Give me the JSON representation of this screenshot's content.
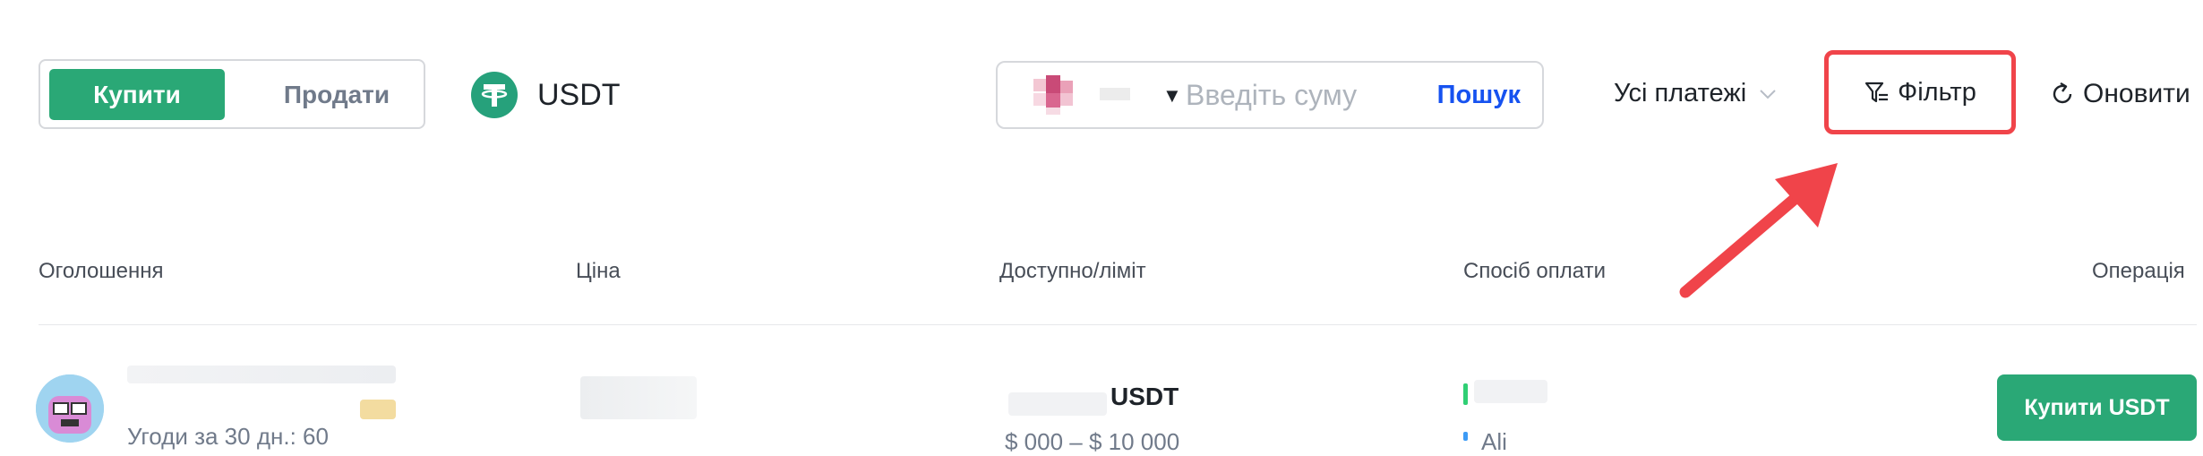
{
  "trade_toggle": {
    "buy": "Купити",
    "sell": "Продати",
    "active": "buy"
  },
  "asset": {
    "label": "USDT",
    "icon": "tether-icon",
    "color": "#26a17b"
  },
  "search": {
    "placeholder": "Введіть суму",
    "button": "Пошук"
  },
  "payments_dropdown": {
    "label": "Усі платежі"
  },
  "filter_button": {
    "label": "Фільтр"
  },
  "refresh_button": {
    "label": "Оновити"
  },
  "table": {
    "headers": [
      "Оголошення",
      "Ціна",
      "Доступно/ліміт",
      "Спосіб оплати",
      "Операція"
    ],
    "rows": [
      {
        "trades": "Угоди за 30 дн.: 60",
        "available_unit": "USDT",
        "limit": "$ 000 – $ 10 000",
        "payment_2": "Ali",
        "action": "Купити USDT"
      }
    ]
  },
  "colors": {
    "accent_green": "#2aa876",
    "highlight_red": "#f0444a",
    "link_blue": "#1652f0"
  }
}
